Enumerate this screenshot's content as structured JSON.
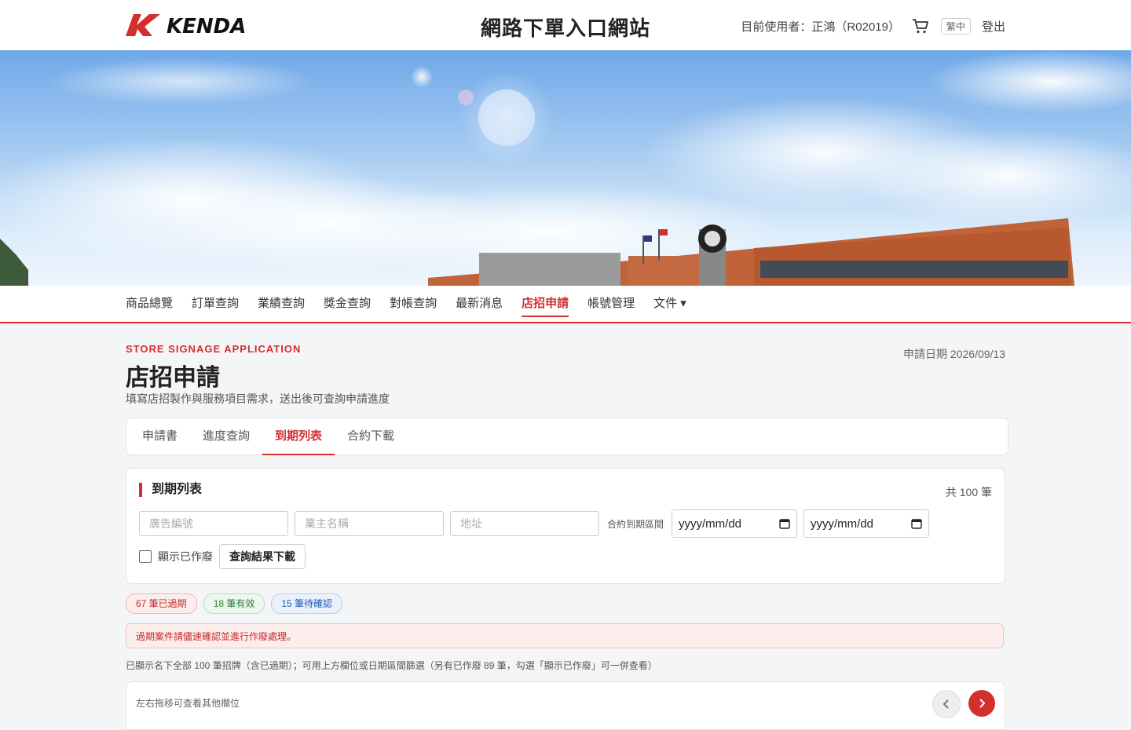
{
  "header": {
    "logo_text": "KENDA",
    "site_title": "網路下單入口網站",
    "user_label": "目前使用者：正鴻（R02019）",
    "lang": "繁中",
    "logout": "登出"
  },
  "nav": {
    "items": [
      "商品總覽",
      "訂單查詢",
      "業績查詢",
      "獎金查詢",
      "對帳查詢",
      "最新消息",
      "店招申請",
      "帳號管理",
      "文件 ▾"
    ],
    "active": "店招申請"
  },
  "page": {
    "eyebrow": "STORE SIGNAGE APPLICATION",
    "title": "店招申請",
    "subtitle": "填寫店招製作與服務項目需求，送出後可查詢申請進度",
    "apply_date": "申請日期 2026/09/13"
  },
  "tabs": [
    "申請書",
    "進度查詢",
    "到期列表",
    "合約下載"
  ],
  "filter": {
    "title": "到期列表",
    "count": "共 100 筆",
    "ad_placeholder": "廣告編號",
    "owner_placeholder": "業主名稱",
    "address_placeholder": "地址",
    "range_label": "合約到期區間",
    "date_from": "yyyy/mm/dd",
    "date_to": "yyyy/mm/dd",
    "show_void_label": "顯示已作廢",
    "download_label": "查詢結果下載"
  },
  "badges": {
    "expired": "67 筆已過期",
    "valid": "18 筆有效",
    "pending": "15 筆待確認"
  },
  "alert": "過期案件請儘速確認並進行作廢處理。",
  "info": "已顯示名下全部 100 筆招牌（含已過期）；可用上方欄位或日期區間篩選（另有已作廢 89 筆，勾選「顯示已作廢」可一併查看）",
  "table": {
    "scroll_hint": "左右拖移可查看其他欄位"
  },
  "colors": {
    "brand_red": "#d32f2f"
  }
}
